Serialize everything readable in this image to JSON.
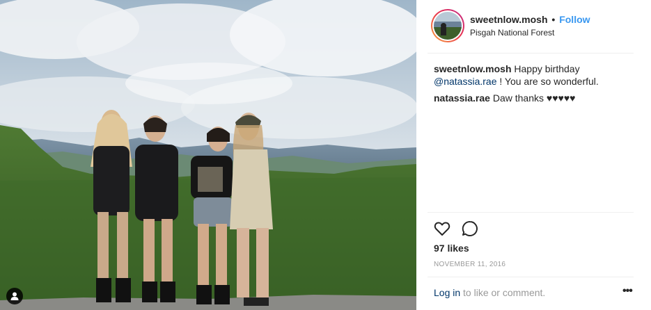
{
  "post": {
    "username": "sweetnlow.mosh",
    "separator": "•",
    "follow_label": "Follow",
    "location": "Pisgah National Forest",
    "comments": [
      {
        "author": "sweetnlow.mosh",
        "text_before": "Happy birthday ",
        "mention": "@natassia.rae",
        "text_after": " ! You are so wonderful."
      },
      {
        "author": "natassia.rae",
        "text": "Daw thanks ",
        "hearts": "♥♥♥♥♥"
      }
    ],
    "likes": "97 likes",
    "date": "NOVEMBER 11, 2016",
    "footer": {
      "login_label": "Log in",
      "rest": " to like or comment."
    },
    "more_label": "•••"
  },
  "icons": {
    "like": "heart-outline-icon",
    "comment": "comment-bubble-icon",
    "tag": "user-tag-icon",
    "more": "more-options-icon"
  },
  "colors": {
    "link_blue": "#3897f0",
    "mention_blue": "#003569",
    "muted": "#999999",
    "text": "#262626"
  }
}
